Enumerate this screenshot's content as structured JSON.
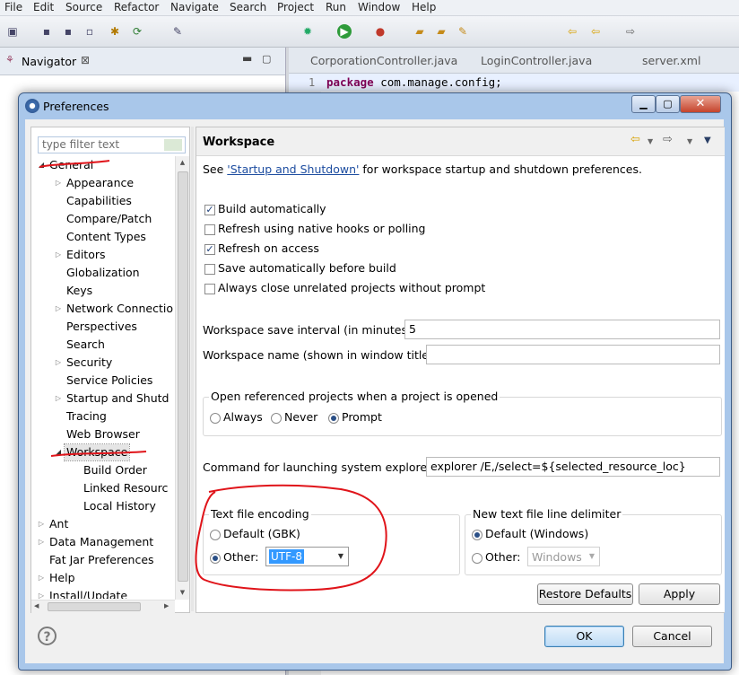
{
  "menubar": {
    "items": [
      "File",
      "Edit",
      "Source",
      "Refactor",
      "Navigate",
      "Search",
      "Project",
      "Run",
      "Window",
      "Help"
    ]
  },
  "navigator": {
    "title": "Navigator"
  },
  "editor": {
    "tabs": [
      "CorporationController.java",
      "LoginController.java",
      "server.xml"
    ],
    "line_number": "1",
    "code_keyword": "package",
    "code_rest": " com.manage.config;"
  },
  "dialog": {
    "title": "Preferences",
    "filter_placeholder": "type filter text",
    "tree": [
      {
        "label": "General",
        "level": 0,
        "expander": "open"
      },
      {
        "label": "Appearance",
        "level": 1,
        "expander": "closed"
      },
      {
        "label": "Capabilities",
        "level": 1,
        "expander": "none"
      },
      {
        "label": "Compare/Patch",
        "level": 1,
        "expander": "none"
      },
      {
        "label": "Content Types",
        "level": 1,
        "expander": "none"
      },
      {
        "label": "Editors",
        "level": 1,
        "expander": "closed"
      },
      {
        "label": "Globalization",
        "level": 1,
        "expander": "none"
      },
      {
        "label": "Keys",
        "level": 1,
        "expander": "none"
      },
      {
        "label": "Network Connectio",
        "level": 1,
        "expander": "closed"
      },
      {
        "label": "Perspectives",
        "level": 1,
        "expander": "none"
      },
      {
        "label": "Search",
        "level": 1,
        "expander": "none"
      },
      {
        "label": "Security",
        "level": 1,
        "expander": "closed"
      },
      {
        "label": "Service Policies",
        "level": 1,
        "expander": "none"
      },
      {
        "label": "Startup and Shutd",
        "level": 1,
        "expander": "closed"
      },
      {
        "label": "Tracing",
        "level": 1,
        "expander": "none"
      },
      {
        "label": "Web Browser",
        "level": 1,
        "expander": "none"
      },
      {
        "label": "Workspace",
        "level": 1,
        "expander": "open",
        "selected": true
      },
      {
        "label": "Build Order",
        "level": 2,
        "expander": "none"
      },
      {
        "label": "Linked Resourc",
        "level": 2,
        "expander": "none"
      },
      {
        "label": "Local History",
        "level": 2,
        "expander": "none"
      },
      {
        "label": "Ant",
        "level": 0,
        "expander": "closed"
      },
      {
        "label": "Data Management",
        "level": 0,
        "expander": "closed"
      },
      {
        "label": "Fat Jar Preferences",
        "level": 0,
        "expander": "none"
      },
      {
        "label": "Help",
        "level": 0,
        "expander": "closed"
      },
      {
        "label": "Install/Update",
        "level": 0,
        "expander": "closed"
      }
    ],
    "page": {
      "title": "Workspace",
      "see_prefix": "See ",
      "see_link": "'Startup and Shutdown'",
      "see_suffix": " for workspace startup and shutdown preferences.",
      "checkboxes": [
        {
          "label": "Build automatically",
          "checked": true
        },
        {
          "label": "Refresh using native hooks or polling",
          "checked": false
        },
        {
          "label": "Refresh on access",
          "checked": true
        },
        {
          "label": "Save automatically before build",
          "checked": false
        },
        {
          "label": "Always close unrelated projects without prompt",
          "checked": false
        }
      ],
      "save_interval_label": "Workspace save interval (in minutes):",
      "save_interval_value": "5",
      "workspace_name_label": "Workspace name (shown in window title):",
      "workspace_name_value": "",
      "open_projects_group": "Open referenced projects when a project is opened",
      "open_projects_options": [
        "Always",
        "Never",
        "Prompt"
      ],
      "open_projects_selected": "Prompt",
      "explorer_label": "Command for launching system explorer:",
      "explorer_value": "explorer /E,/select=${selected_resource_loc}",
      "encoding_group": "Text file encoding",
      "encoding_default": "Default (GBK)",
      "encoding_other": "Other:",
      "encoding_value": "UTF-8",
      "delimiter_group": "New text file line delimiter",
      "delimiter_default": "Default (Windows)",
      "delimiter_other": "Other:",
      "delimiter_value": "Windows",
      "restore_defaults": "Restore Defaults",
      "apply": "Apply"
    },
    "ok": "OK",
    "cancel": "Cancel",
    "help_symbol": "?"
  }
}
